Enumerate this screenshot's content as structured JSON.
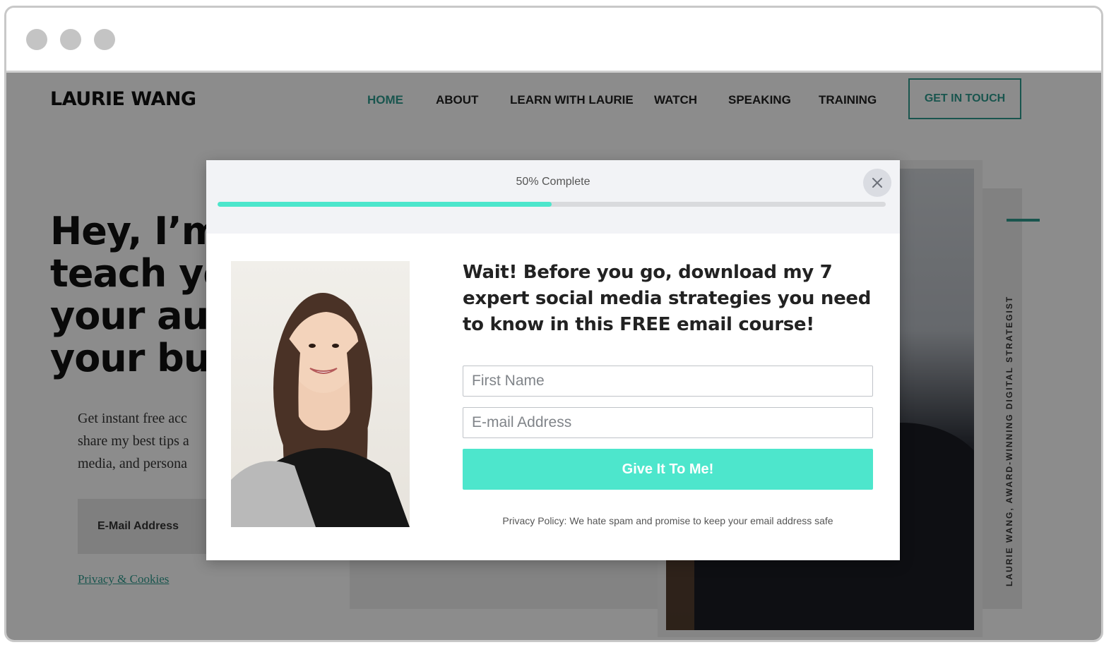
{
  "site": {
    "logo": "LAURIE WANG",
    "nav": [
      "HOME",
      "ABOUT",
      "LEARN WITH LAURIE",
      "WATCH",
      "SPEAKING",
      "TRAINING"
    ],
    "cta": "GET IN TOUCH"
  },
  "hero": {
    "title_lines": [
      "Hey, I’m",
      "teach yo",
      "your aud",
      "your bus"
    ],
    "subtitle_lines": [
      "Get instant free acc",
      "share my best tips a",
      "media, and persona"
    ],
    "email_label": "E-Mail Address",
    "privacy_link": "Privacy & Cookies",
    "vertical_caption": "LAURIE WANG, AWARD-WINNING DIGITAL STRATEGIST"
  },
  "modal": {
    "progress_text": "50% Complete",
    "progress": 0.5,
    "close_icon": "close-icon",
    "headline": "Wait! Before you go, download my 7 expert social media strategies you need to know in this FREE email course!",
    "first_name_placeholder": "First Name",
    "email_placeholder": "E-mail Address",
    "submit_label": "Give It To Me!",
    "privacy": "Privacy Policy: We hate spam and promise to keep your email address safe"
  },
  "colors": {
    "accent": "#2f9c8f",
    "progress": "#4de6cc",
    "button": "#4de6cc"
  }
}
